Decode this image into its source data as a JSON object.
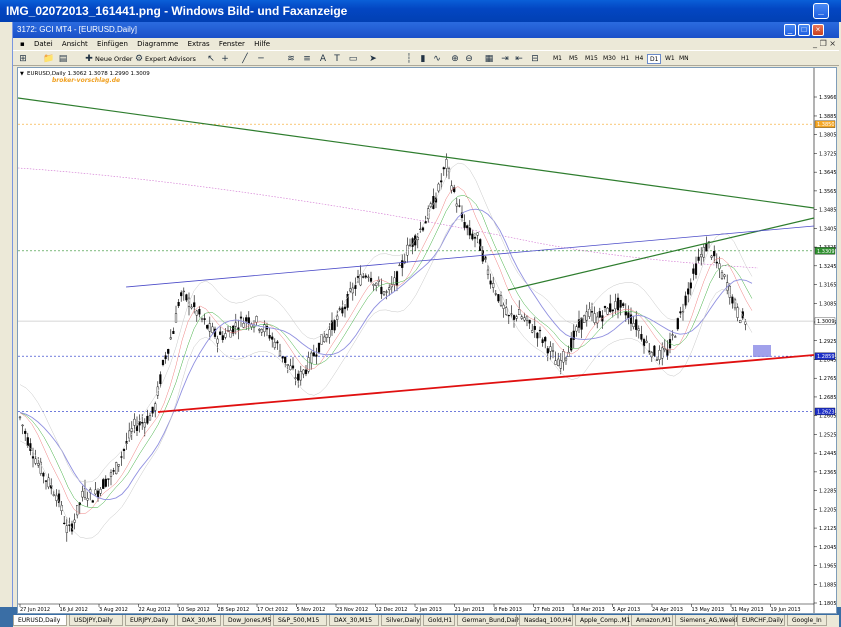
{
  "outer_window": {
    "title": "IMG_02072013_161441.png - Windows Bild- und Faxanzeige"
  },
  "inner_window": {
    "title": "3172: GCI MT4 - [EURUSD,Daily]"
  },
  "menu": [
    "Datei",
    "Ansicht",
    "Einfügen",
    "Diagramme",
    "Extras",
    "Fenster",
    "Hilfe"
  ],
  "toolbar": {
    "new_order": "Neue Order",
    "expert_advisors": "Expert Advisors",
    "timeframes": [
      "M1",
      "M5",
      "M15",
      "M30",
      "H1",
      "H4",
      "D1",
      "W1",
      "MN"
    ],
    "selected_timeframe": "D1"
  },
  "chart": {
    "info": "EURUSD,Daily  1.3062 1.3078 1.2990 1.3009",
    "watermark": "broker-vorschlag.de",
    "price_labels": [
      "1.3966",
      "1.3885",
      "1.3805",
      "1.3725",
      "1.3645",
      "1.3565",
      "1.3485",
      "1.3405",
      "1.3325",
      "1.3245",
      "1.3165",
      "1.3085",
      "1.3005",
      "1.2925",
      "1.2845",
      "1.2765",
      "1.2685",
      "1.2605",
      "1.2525",
      "1.2445",
      "1.2365",
      "1.2285",
      "1.2205",
      "1.2125",
      "1.2045",
      "1.1965",
      "1.1885",
      "1.1805"
    ],
    "highlight_labels": [
      {
        "text": "1.3850",
        "price": 1.385,
        "bg": "#f5a623"
      },
      {
        "text": "1.3309",
        "price": 1.3309,
        "bg": "#2f8f2f"
      },
      {
        "text": "1.3009",
        "price": 1.3009,
        "bg": "#ffffff"
      },
      {
        "text": "1.2859",
        "price": 1.2859,
        "bg": "#1d2fc7"
      },
      {
        "text": "1.2623",
        "price": 1.2623,
        "bg": "#1d2fc7"
      }
    ],
    "date_labels": [
      "27 Jun 2012",
      "16 Jul 2012",
      "3 Aug 2012",
      "22 Aug 2012",
      "10 Sep 2012",
      "28 Sep 2012",
      "17 Oct 2012",
      "5 Nov 2012",
      "23 Nov 2012",
      "12 Dec 2012",
      "2 Jan 2013",
      "21 Jan 2013",
      "8 Feb 2013",
      "27 Feb 2013",
      "18 Mar 2013",
      "5 Apr 2013",
      "24 Apr 2013",
      "13 May 2013",
      "31 May 2013",
      "19 Jun 2013"
    ]
  },
  "tabs": [
    "EURUSD,Daily",
    "USDJPY,Daily",
    "EURJPY,Daily",
    "DAX_30,M5",
    "Dow_Jones,M5",
    "S&P_500,M15",
    "DAX_30,M15",
    "Silver,Daily",
    "Gold,H1",
    "German_Bund,Daily",
    "Nasdaq_100,H4",
    "Apple_Comp.,M1",
    "Amazon,M1",
    "Siemens_AG,Weekly",
    "EURCHF,Daily",
    "Google_In"
  ],
  "active_tab": "EURUSD,Daily",
  "colors": {
    "green_line": "#2e7d2e",
    "blue_line": "#4b4bc8",
    "red_line": "#e01010",
    "candle": "#000000"
  }
}
